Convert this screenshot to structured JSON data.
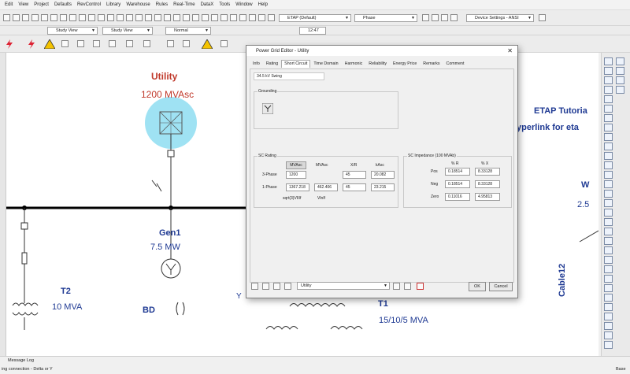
{
  "menu": [
    "Edit",
    "View",
    "Project",
    "Defaults",
    "RevControl",
    "Library",
    "Warehouse",
    "Rules",
    "Real-Time",
    "DataX",
    "Tools",
    "Window",
    "Help"
  ],
  "toolbar": {
    "project_dropdown": "ETAP (Default)",
    "phase_dropdown": "Phase",
    "device_settings": "Device Settings - ANSI",
    "study_view_1": "Study View",
    "study_view_2": "Study View",
    "normal_mode": "Normal",
    "time_field": "12:47"
  },
  "diagram": {
    "utility_name": "Utility",
    "utility_rating": "1200 MVAsc",
    "gen_name": "Gen1",
    "gen_rating": "7.5 MW",
    "t2_name": "T2",
    "t2_rating": "10 MVA",
    "bd_label": "BD",
    "t1_name": "T1",
    "t1_rating": "15/10/5 MVA",
    "tutorial_text": "ETAP Tutoria",
    "hyperlink_text": "yperlink for eta",
    "w_label": "W",
    "right_rating": "2.5",
    "cable_label": "Cable12",
    "partial_label": "Y"
  },
  "dialog": {
    "title": "Power Grid Editor - Utility",
    "tabs": [
      "Info",
      "Rating",
      "Short Circuit",
      "Time Domain",
      "Harmonic",
      "Reliability",
      "Energy Price",
      "Remarks",
      "Comment"
    ],
    "active_tab": "Short Circuit",
    "header_value": "34.5 kV  Swing",
    "grounding_label": "Grounding",
    "sc_rating": {
      "label": "SC Rating",
      "col_mvasc": "MVAsc",
      "col_mvasc2": "MVAsc",
      "col_xr": "X/R",
      "col_kasc": "kAsc",
      "row_3phase": "3-Phase",
      "row_1phase": "1-Phase",
      "v3_mvasc": "1200",
      "v3_xr": "45",
      "v3_kasc": "20.082",
      "v1_mvasc": "1367.218",
      "v1_mvasc2": "462.406",
      "v1_xr": "45",
      "v1_kasc": "23.215",
      "footnote_1": "sqrt(3)VIIIf",
      "footnote_2": "VlnIf"
    },
    "sc_impedance": {
      "label": "SC Impedance (100 MVAb)",
      "col_r": "% R",
      "col_x": "% X",
      "row_pos": "Pos",
      "row_neg": "Neg",
      "row_zero": "Zero",
      "pos_r": "0.18514",
      "pos_x": "8.33128",
      "neg_r": "0.18514",
      "neg_x": "8.33128",
      "zero_r": "0.11016",
      "zero_x": "4.95813"
    },
    "bottom_dropdown": "Utility",
    "ok_label": "OK",
    "cancel_label": "Cancel"
  },
  "status": {
    "message_log": "Message Log",
    "hint": "ing connection - Delta or Y",
    "base": "Base"
  },
  "colors": {
    "red_label": "#c0392b",
    "blue_label": "#1f3a93",
    "highlight": "#7fd8ef",
    "bus": "#000000"
  }
}
